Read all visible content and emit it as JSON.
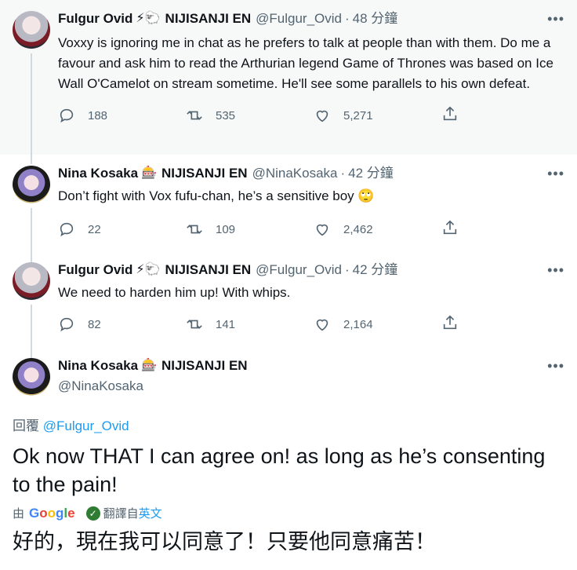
{
  "tweets": [
    {
      "name": "Fulgur Ovid",
      "emojis": "⚡🐑",
      "org": "NIJISANJI EN",
      "handle": "@Fulgur_Ovid",
      "time": "48 分鐘",
      "text": "Voxxy is ignoring me in chat as he prefers to talk at people than with them. Do me a favour and ask him to read the Arthurian legend Game of Thrones was based on Ice Wall O'Camelot on stream sometime. He'll see some parallels to his own defeat.",
      "replies": "188",
      "retweets": "535",
      "likes": "5,271"
    },
    {
      "name": "Nina Kosaka",
      "emojis": "🎰",
      "org": "NIJISANJI EN",
      "handle": "@NinaKosaka",
      "time": "42 分鐘",
      "text": "Don’t fight with Vox fufu-chan, he’s a sensitive boy 🙄",
      "replies": "22",
      "retweets": "109",
      "likes": "2,462"
    },
    {
      "name": "Fulgur Ovid",
      "emojis": "⚡🐑",
      "org": "NIJISANJI EN",
      "handle": "@Fulgur_Ovid",
      "time": "42 分鐘",
      "text": "We need to harden him up! With whips.",
      "replies": "82",
      "retweets": "141",
      "likes": "2,164"
    }
  ],
  "main": {
    "name": "Nina Kosaka",
    "emojis": "🎰",
    "org": "NIJISANJI EN",
    "handle": "@NinaKosaka",
    "reply_prefix": "回覆",
    "reply_to": "@Fulgur_Ovid",
    "text": "Ok now THAT I can agree on! as long as he’s consenting to the pain!",
    "translate_by": "由",
    "translate_action": "翻譯自",
    "translate_lang": "英文",
    "translated_text": "好的，現在我可以同意了！只要他同意痛苦！"
  },
  "dot": "·",
  "more_label": "•••"
}
